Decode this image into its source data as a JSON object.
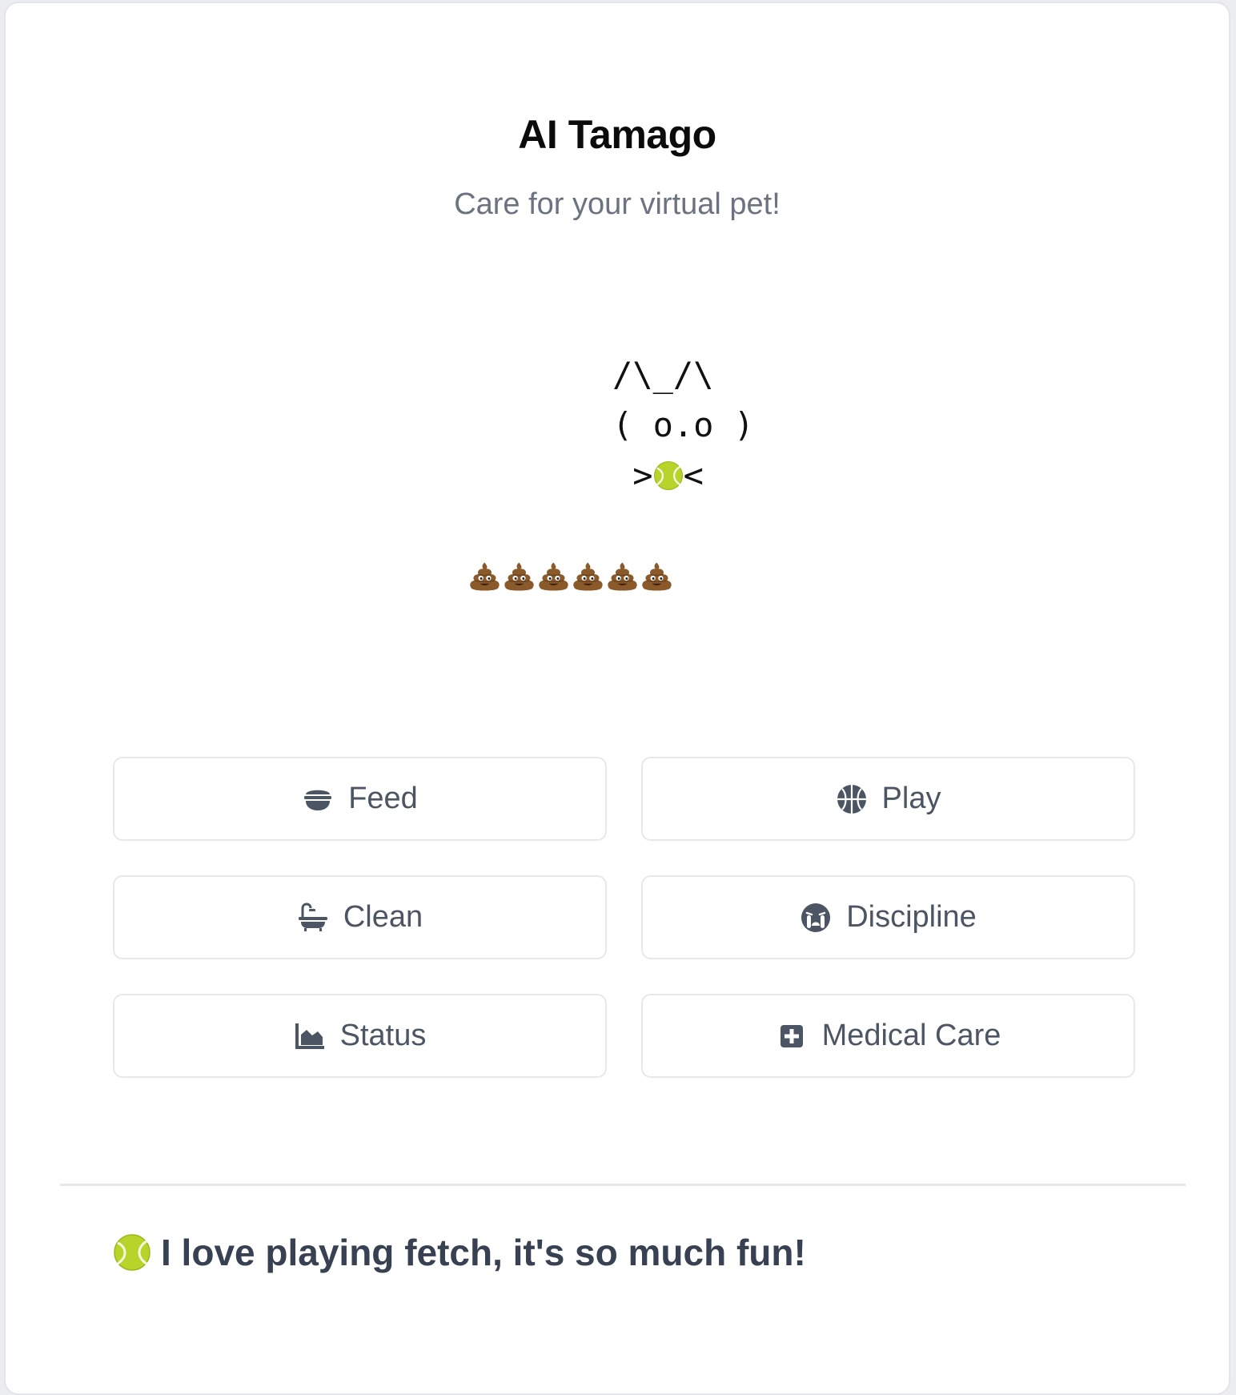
{
  "header": {
    "title": "AI Tamago",
    "subtitle": "Care for your virtual pet!"
  },
  "pet": {
    "line1": "/\\_/\\",
    "line2": "( o.o )",
    "line3_left": ">",
    "line3_right": "<",
    "mouth_icon": "tennis-ball-icon"
  },
  "poop": {
    "count": 6,
    "icon": "poop-icon"
  },
  "actions": [
    {
      "label": "Feed",
      "icon": "bowl-icon"
    },
    {
      "label": "Play",
      "icon": "basketball-icon"
    },
    {
      "label": "Clean",
      "icon": "bathtub-icon"
    },
    {
      "label": "Discipline",
      "icon": "crying-face-icon"
    },
    {
      "label": "Status",
      "icon": "area-chart-icon"
    },
    {
      "label": "Medical Care",
      "icon": "medical-kit-icon"
    }
  ],
  "message": {
    "icon": "tennis-ball-icon",
    "text": "I love playing fetch, it's so much fun!"
  },
  "colors": {
    "title": "#0b0b0b",
    "subtitle": "#6b7280",
    "button_text": "#4b5563",
    "message_text": "#374151",
    "border": "#e6e8ec"
  }
}
